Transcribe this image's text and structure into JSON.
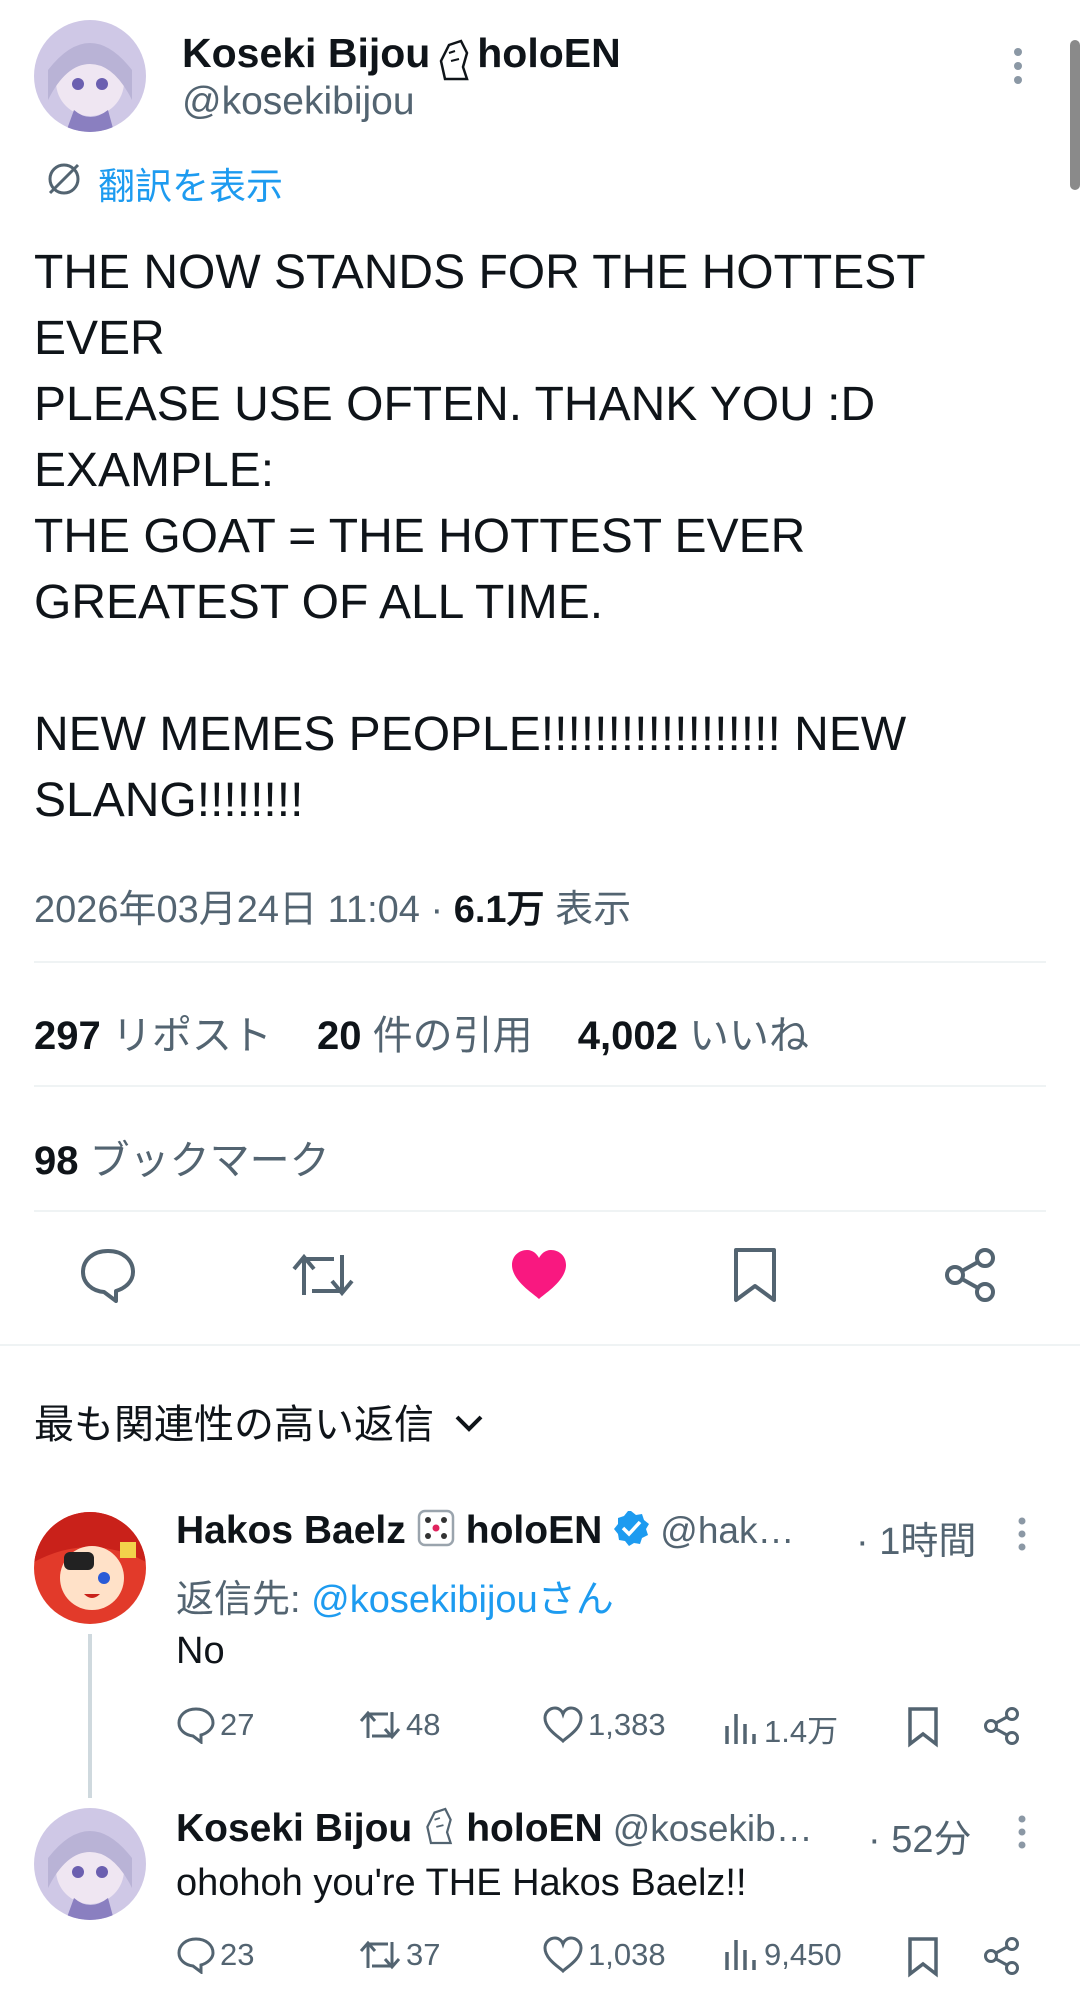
{
  "tweet": {
    "author_name": "Koseki Bijou",
    "author_suffix": "holoEN",
    "author_handle": "@kosekibijou",
    "translate_label": "翻訳を表示",
    "text": "THE NOW STANDS FOR THE HOTTEST\nEVER\nPLEASE USE OFTEN. THANK YOU :D\nEXAMPLE:\nTHE GOAT = THE HOTTEST EVER\nGREATEST OF ALL TIME.\n\nNEW MEMES PEOPLE!!!!!!!!!!!!!!!!!! NEW\nSLANG!!!!!!!!",
    "timestamp": "2026年03月24日 11:04",
    "separator": " · ",
    "views_count": "6.1万",
    "views_label": " 表示"
  },
  "stats": {
    "reposts_count": "297",
    "reposts_label": " リポスト",
    "quotes_count": "20",
    "quotes_label": " 件の引用",
    "likes_count": "4,002",
    "likes_label": " いいね",
    "bookmarks_count": "98",
    "bookmarks_label": " ブックマーク"
  },
  "colors": {
    "accent": "#1d9bf0",
    "like": "#f91880",
    "text": "#0f1419",
    "muted": "#536471"
  },
  "replies_section": {
    "title": "最も関連性の高い返信"
  },
  "replies": [
    {
      "name": "Hakos Baelz",
      "suffix": "holoEN",
      "handle": "@hak…",
      "time": "· 1時間",
      "reply_to_prefix": "返信先: ",
      "reply_to_handle": "@kosekibijouさん",
      "text": "No",
      "comments": "27",
      "reposts": "48",
      "likes": "1,383",
      "views": "1.4万"
    },
    {
      "name": "Koseki Bijou",
      "suffix": "holoEN",
      "handle": "@kosekib…",
      "time": "· 52分",
      "text": "ohohoh you're THE Hakos Baelz!!",
      "comments": "23",
      "reposts": "37",
      "likes": "1,038",
      "views": "9,450"
    }
  ]
}
